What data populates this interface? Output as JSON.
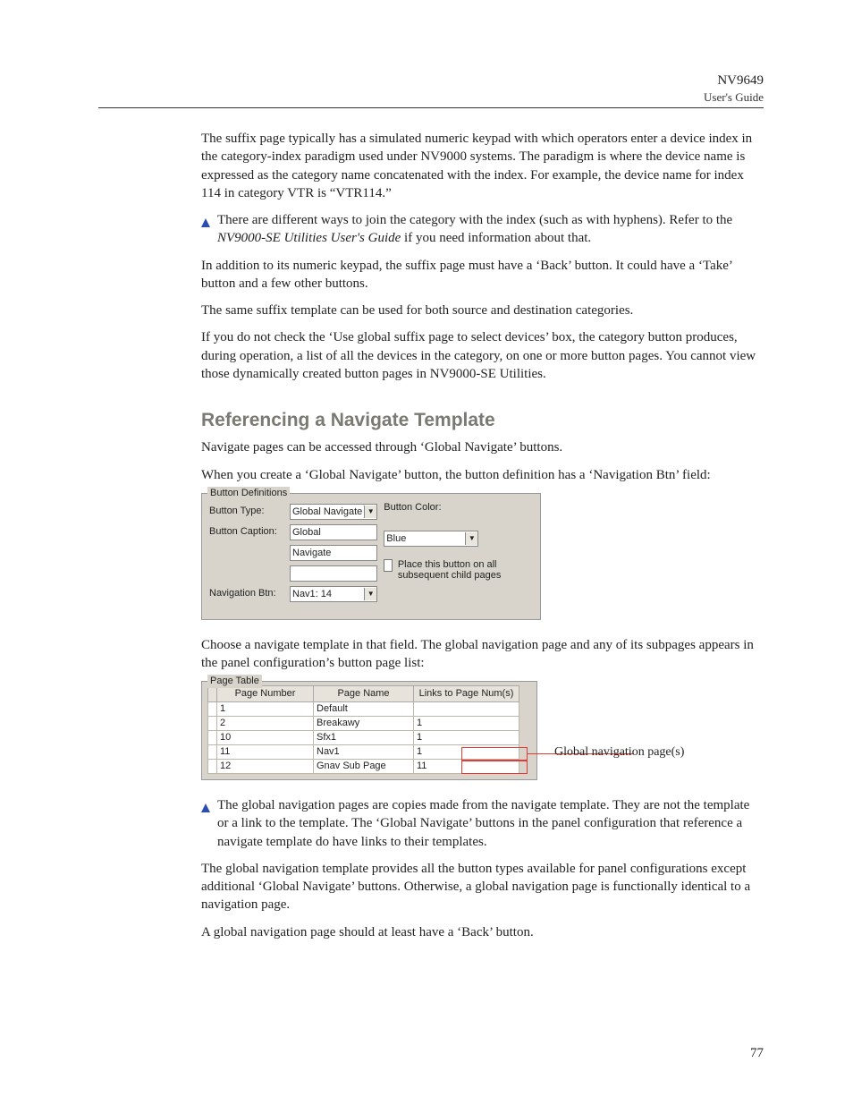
{
  "header": {
    "product": "NV9649",
    "subtitle": "User's Guide"
  },
  "body": {
    "p1": "The suffix page typically has a simulated numeric keypad with which operators enter a device index in the category-index paradigm used under NV9000 systems. The paradigm is where the device name is expressed as the category name concatenated with the index. For example, the device name for index 114 in category VTR is “VTR114.”",
    "note1a": "There are different ways to join the category with the index (such as with hyphens). Refer to the ",
    "note1_em": "NV9000-SE Utilities User's Guide",
    "note1b": " if you need information about that.",
    "p2": "In addition to its numeric keypad, the suffix page must have a ‘Back’ button. It could have a ‘Take’ button and a few other buttons.",
    "p3": "The same suffix template can be used for both source and destination categories.",
    "p4": "If you do not check the ‘Use global suffix page to select devices’ box, the category button produces, during operation, a list of all the devices in the category, on one or more button pages. You cannot view those dynamically created button pages in NV9000-SE Utilities.",
    "h2": "Referencing a Navigate Template",
    "p5": "Navigate pages can be accessed through ‘Global Navigate’ buttons.",
    "p6": "When you create a ‘Global Navigate’ button, the button definition has a ‘Navigation Btn’ field:",
    "p7": "Choose a navigate template in that field. The global navigation page and any of its subpages appears in the panel configuration’s button page list:",
    "note2": "The global navigation pages are copies made from the navigate template. They are not the template or a link to the template. The ‘Global Navigate’ buttons in the panel configuration that reference a navigate template do have links to their templates.",
    "p8": "The global navigation template provides all the button types available for panel configurations except additional ‘Global Navigate’ buttons. Otherwise, a global navigation page is functionally identical to a navigation page.",
    "p9": "A global navigation page should at least have a ‘Back’ button."
  },
  "btn_def": {
    "legend": "Button Definitions",
    "lbl_type": "Button Type:",
    "val_type": "Global Navigate",
    "lbl_caption": "Button Caption:",
    "val_caption1": "Global",
    "val_caption2": "Navigate",
    "val_caption3": "",
    "lbl_nav": "Navigation Btn:",
    "val_nav": "Nav1: 14",
    "lbl_color": "Button Color:",
    "val_color": "Blue",
    "cb_label": "Place this button on all subsequent child pages"
  },
  "ptable": {
    "legend": "Page Table",
    "headers": [
      "Page Number",
      "Page Name",
      "Links to Page Num(s)"
    ],
    "rows": [
      {
        "pn": "1",
        "nm": "Default",
        "ln": ""
      },
      {
        "pn": "2",
        "nm": "Breakawy",
        "ln": "1"
      },
      {
        "pn": "10",
        "nm": "Sfx1",
        "ln": "1"
      },
      {
        "pn": "11",
        "nm": "Nav1",
        "ln": "1"
      },
      {
        "pn": "12",
        "nm": "Gnav Sub Page",
        "ln": "11"
      }
    ],
    "callout": "Global navigation page(s)"
  },
  "page_number": "77"
}
